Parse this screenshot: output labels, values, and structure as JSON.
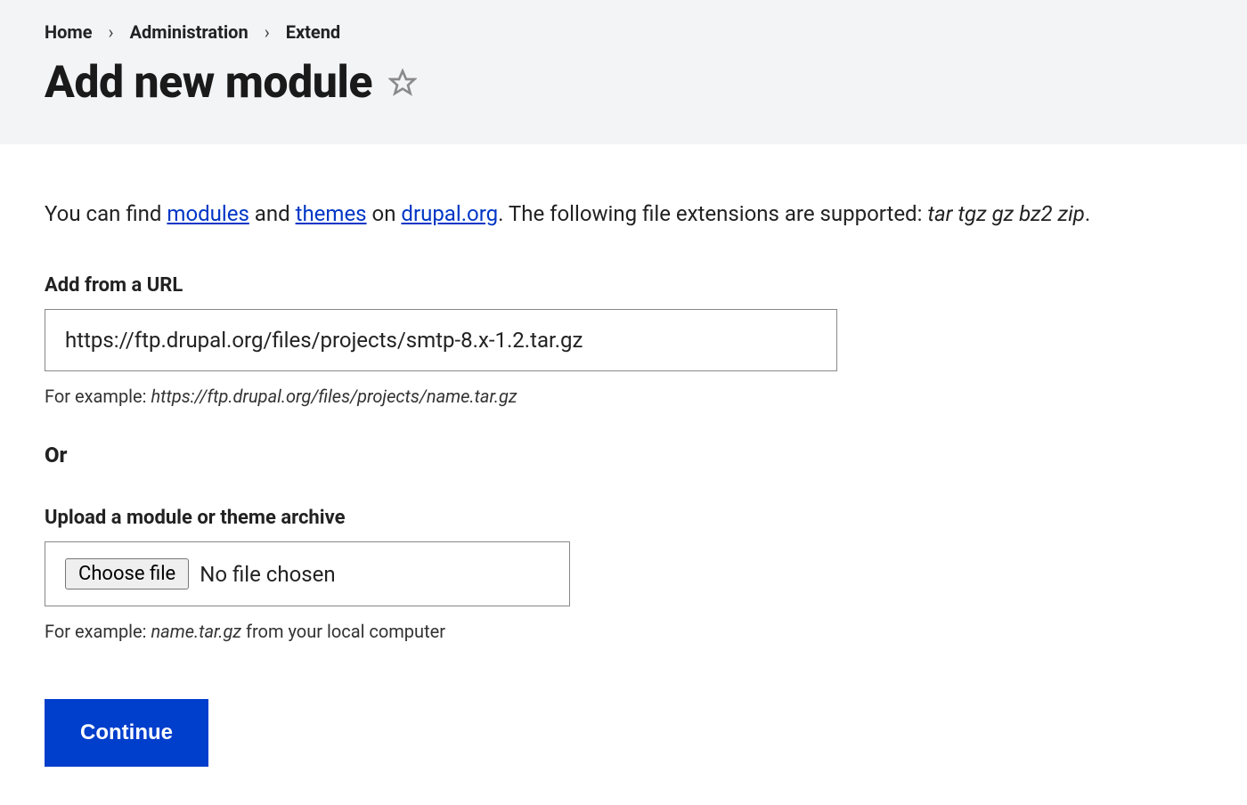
{
  "breadcrumb": {
    "items": [
      {
        "label": "Home"
      },
      {
        "label": "Administration"
      },
      {
        "label": "Extend"
      }
    ]
  },
  "page_title": "Add new module",
  "intro": {
    "prefix": "You can find ",
    "modules_link": "modules",
    "and": " and ",
    "themes_link": "themes",
    "on": " on ",
    "drupal_link": "drupal.org",
    "suffix": ". The following file extensions are supported: ",
    "extensions": "tar tgz gz bz2 zip",
    "period": "."
  },
  "url_section": {
    "label": "Add from a URL",
    "value": "https://ftp.drupal.org/files/projects/smtp-8.x-1.2.tar.gz",
    "help_prefix": "For example: ",
    "help_example": "https://ftp.drupal.org/files/projects/name.tar.gz"
  },
  "or_label": "Or",
  "upload_section": {
    "label": "Upload a module or theme archive",
    "choose_button": "Choose file",
    "file_status": "No file chosen",
    "help_prefix": "For example: ",
    "help_example": "name.tar.gz",
    "help_suffix": " from your local computer"
  },
  "continue_button": "Continue"
}
